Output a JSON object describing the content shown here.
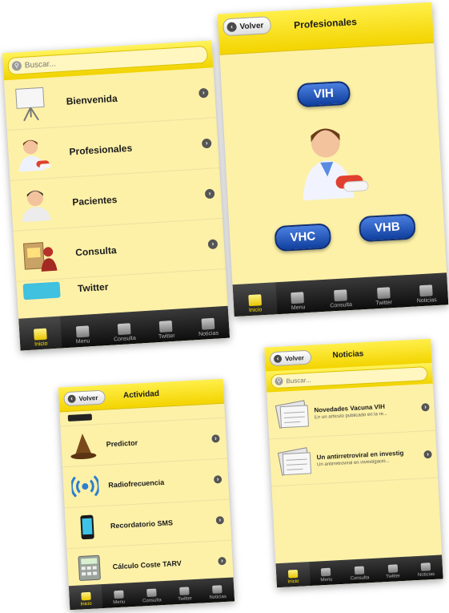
{
  "tab_labels": [
    "Inicio",
    "Menu",
    "Consulta",
    "Twitter",
    "Noticias"
  ],
  "screen_home": {
    "search_placeholder": "Buscar...",
    "items": [
      {
        "label": "Bienvenida",
        "icon": "presentation-board-icon"
      },
      {
        "label": "Profesionales",
        "icon": "doctor-icon"
      },
      {
        "label": "Pacientes",
        "icon": "patient-icon"
      },
      {
        "label": "Consulta",
        "icon": "consultation-icon"
      },
      {
        "label": "Twitter",
        "icon": "twitter-icon"
      }
    ]
  },
  "screen_profesionales": {
    "back_label": "Volver",
    "title": "Profesionales",
    "buttons": [
      "VIH",
      "VHC",
      "VHB"
    ]
  },
  "screen_actividad": {
    "back_label": "Volver",
    "title": "Actividad",
    "items": [
      {
        "label": "Predictor",
        "icon": "wizard-hat-icon"
      },
      {
        "label": "Radiofrecuencia",
        "icon": "wireless-signal-icon"
      },
      {
        "label": "Recordatorio SMS",
        "icon": "smartphone-icon"
      },
      {
        "label": "Cálculo Coste TARV",
        "icon": "calculator-icon"
      }
    ]
  },
  "screen_noticias": {
    "back_label": "Volver",
    "title": "Noticias",
    "search_placeholder": "Buscar...",
    "items": [
      {
        "title": "Novedades Vacuna VIH",
        "snippet": "En un artículo publicado en la re...",
        "icon": "newspaper-icon"
      },
      {
        "title": "Un antirretroviral en investig",
        "snippet": "Un antirretroviral en investigació...",
        "icon": "newspaper-icon"
      }
    ]
  },
  "colors": {
    "bar_yellow": "#f3d400",
    "background": "#fdf1a8",
    "button_blue": "#1c52c0"
  }
}
